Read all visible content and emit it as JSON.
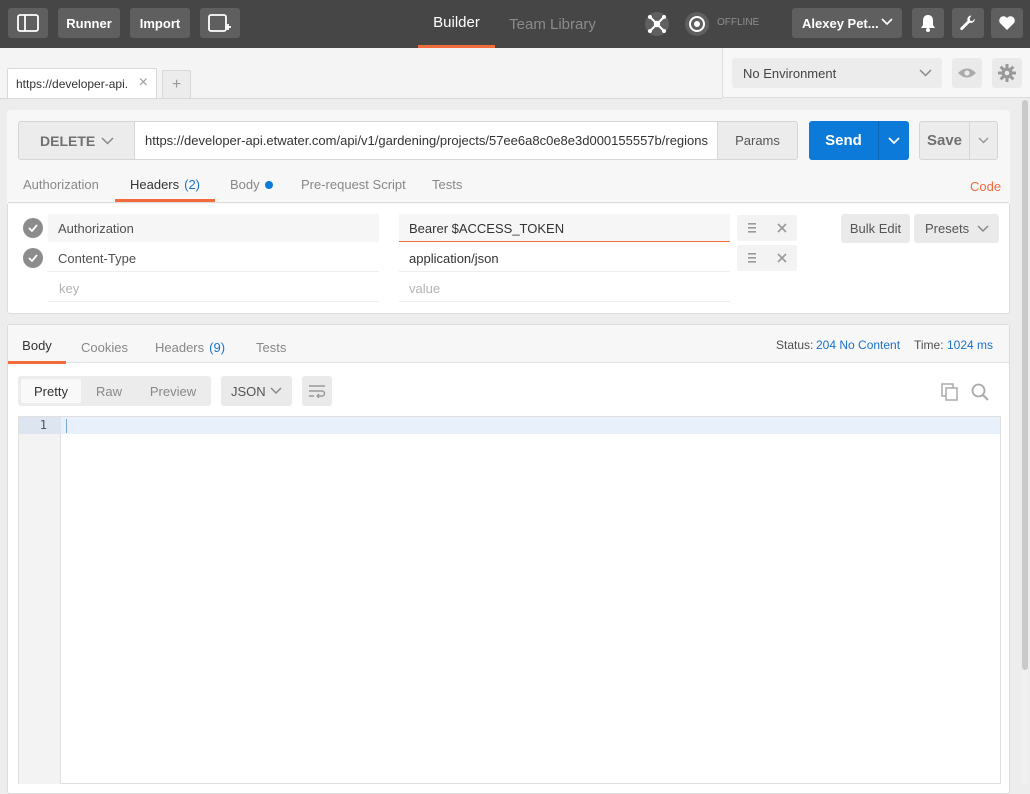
{
  "topbar": {
    "runner_label": "Runner",
    "import_label": "Import",
    "builder_tab": "Builder",
    "team_library_tab": "Team Library",
    "offline_label": "OFFLINE",
    "user_name": "Alexey Pet..."
  },
  "request_tabs": {
    "active_tab_label": "https://developer-api.",
    "close_glyph": "×",
    "new_tab_glyph": "+"
  },
  "environment": {
    "selected": "No Environment"
  },
  "request": {
    "method": "DELETE",
    "url": "https://developer-api.etwater.com/api/v1/gardening/projects/57ee6a8c0e8e3d000155557b/regions",
    "params_label": "Params",
    "send_label": "Send",
    "save_label": "Save"
  },
  "request_subtabs": {
    "authorization": "Authorization",
    "headers": "Headers",
    "headers_count": "(2)",
    "body": "Body",
    "pre_request": "Pre-request Script",
    "tests": "Tests",
    "code": "Code"
  },
  "headers": {
    "rows": [
      {
        "key": "Authorization",
        "value": "Bearer $ACCESS_TOKEN"
      },
      {
        "key": "Content-Type",
        "value": "application/json"
      }
    ],
    "key_placeholder": "key",
    "value_placeholder": "value",
    "bulk_edit_label": "Bulk Edit",
    "presets_label": "Presets"
  },
  "response": {
    "tabs": {
      "body": "Body",
      "cookies": "Cookies",
      "headers": "Headers",
      "headers_count": "(9)",
      "tests": "Tests"
    },
    "status_label": "Status:",
    "status_value": "204 No Content",
    "time_label": "Time:",
    "time_value": "1024 ms",
    "view_modes": [
      "Pretty",
      "Raw",
      "Preview"
    ],
    "format": "JSON",
    "line_number": "1"
  },
  "colors": {
    "topbar": "#464646",
    "accent_orange": "#f26b3a",
    "send_blue": "#0c7ad9",
    "link_blue": "#1a73c9"
  }
}
